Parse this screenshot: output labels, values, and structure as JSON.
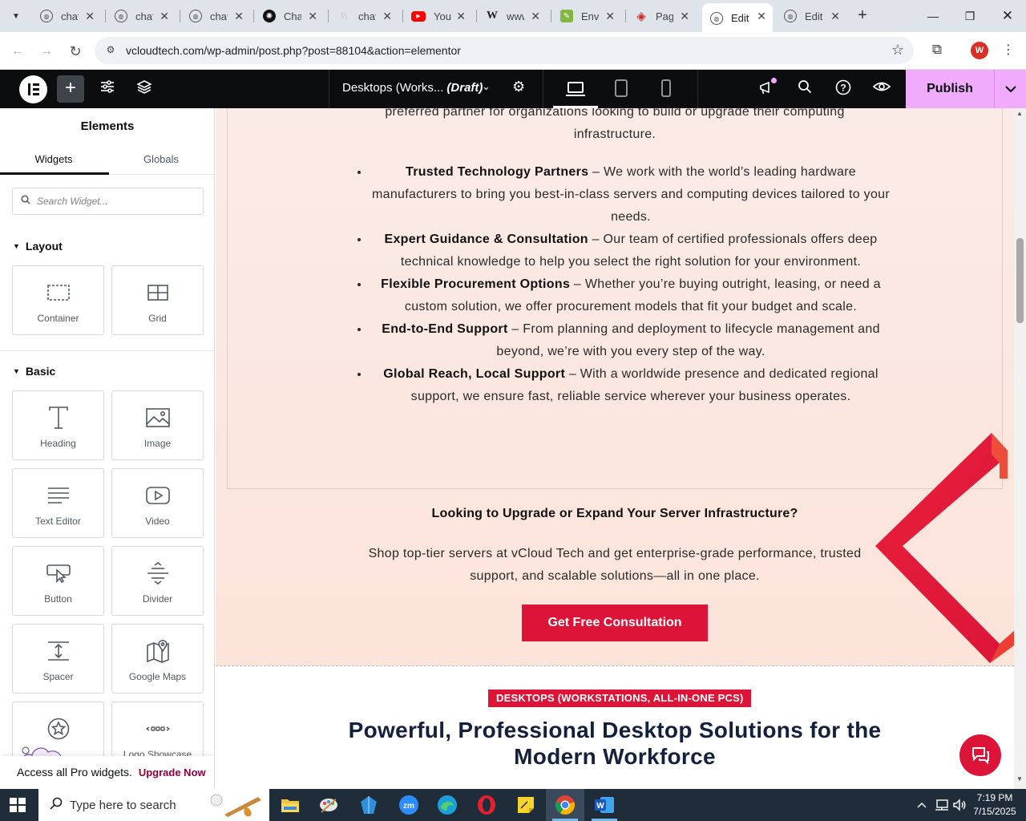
{
  "browser": {
    "tabs": [
      {
        "title": "chat",
        "icon": "globe-icon"
      },
      {
        "title": "chat",
        "icon": "globe-icon"
      },
      {
        "title": "chat",
        "icon": "globe-icon"
      },
      {
        "title": "Cha",
        "icon": "openai-icon"
      },
      {
        "title": "chat",
        "icon": "ghost-icon"
      },
      {
        "title": "You",
        "icon": "youtube-icon"
      },
      {
        "title": "www",
        "icon": "wikipedia-icon"
      },
      {
        "title": "Enva",
        "icon": "envato-icon"
      },
      {
        "title": "Pag",
        "icon": "pdf-icon"
      },
      {
        "title": "Edit",
        "icon": "globe-icon",
        "active": true
      },
      {
        "title": "Edit",
        "icon": "globe-icon"
      }
    ],
    "url": "vcloudtech.com/wp-admin/post.php?post=88104&action=elementor",
    "profile_initial": "W"
  },
  "editor": {
    "doc_title": "Desktops (Works...",
    "doc_status": "(Draft)",
    "publish_label": "Publish"
  },
  "panel": {
    "title": "Elements",
    "tabs": [
      "Widgets",
      "Globals"
    ],
    "search_placeholder": "Search Widget...",
    "layout_label": "Layout",
    "basic_label": "Basic",
    "layout_widgets": [
      "Container",
      "Grid"
    ],
    "basic_widgets": [
      "Heading",
      "Image",
      "Text Editor",
      "Video",
      "Button",
      "Divider",
      "Spacer",
      "Google Maps",
      "",
      "Logo Showcase"
    ],
    "upgrade_text": "Access all Pro widgets.",
    "upgrade_link": "Upgrade Now"
  },
  "canvas": {
    "intro_line1": "preferred partner for organizations looking to build or upgrade their computing",
    "intro_line2": "infrastructure.",
    "bullets": [
      {
        "bold": "Trusted Technology Partners",
        "text": " – We work with the world’s leading hardware manufacturers to bring you best-in-class servers and computing devices tailored to your needs."
      },
      {
        "bold": "Expert Guidance & Consultation",
        "text": " – Our team of certified professionals offers deep technical knowledge to help you select the right solution for your environment."
      },
      {
        "bold": "Flexible Procurement Options",
        "text": " – Whether you’re buying outright, leasing, or need a custom solution, we offer procurement models that fit your budget and scale."
      },
      {
        "bold": "End-to-End Support",
        "text": " – From planning and deployment to lifecycle management and beyond, we’re with you every step of the way."
      },
      {
        "bold": "Global Reach, Local Support",
        "text": " – With a worldwide presence and dedicated regional support, we ensure fast, reliable service wherever your business operates."
      }
    ],
    "cta_heading": "Looking to Upgrade or Expand Your Server Infrastructure?",
    "cta_text": "Shop top-tier servers at vCloud Tech and get enterprise-grade performance, trusted support, and scalable solutions—all in one place.",
    "cta_button": "Get Free Consultation",
    "badge": "DESKTOPS (WORKSTATIONS, ALL-IN-ONE PCS)",
    "section_heading": "Powerful, Professional Desktop Solutions for the Modern Workforce"
  },
  "taskbar": {
    "search_placeholder": "Type here to search",
    "time": "7:19 PM",
    "date": "7/15/2025"
  },
  "colors": {
    "accent_red": "#dc1437",
    "publish_pink": "#f0abfc",
    "editor_dark": "#0c0d0e",
    "heading_navy": "#13213d"
  }
}
